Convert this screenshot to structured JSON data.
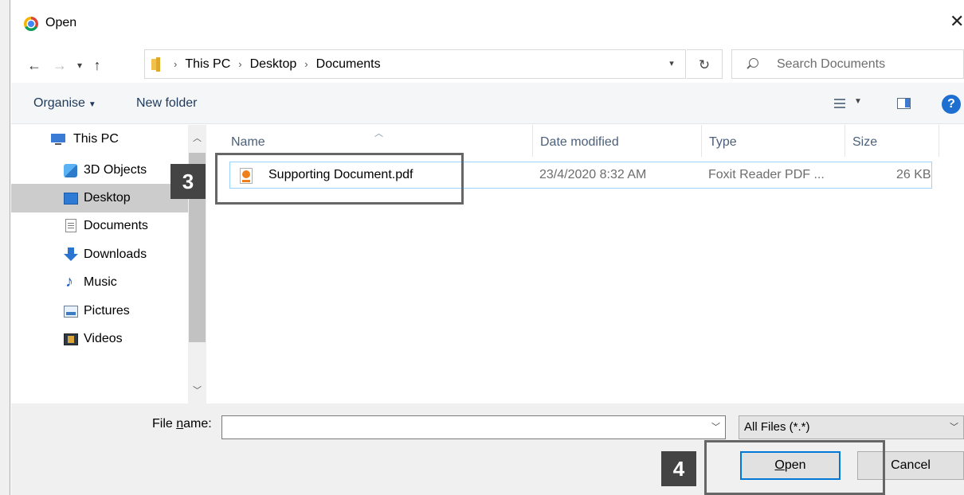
{
  "window": {
    "title": "Open"
  },
  "nav": {
    "breadcrumbs": [
      "This PC",
      "Desktop",
      "Documents"
    ],
    "search_placeholder": "Search Documents"
  },
  "toolbar": {
    "organise_label": "Organise",
    "new_folder_label": "New folder",
    "help_label": "?"
  },
  "sidebar": {
    "items": [
      {
        "label": "This PC",
        "icon": "computer-icon"
      },
      {
        "label": "3D Objects",
        "icon": "3d-objects-icon"
      },
      {
        "label": "Desktop",
        "icon": "desktop-icon",
        "selected": true
      },
      {
        "label": "Documents",
        "icon": "documents-icon"
      },
      {
        "label": "Downloads",
        "icon": "downloads-icon"
      },
      {
        "label": "Music",
        "icon": "music-icon"
      },
      {
        "label": "Pictures",
        "icon": "pictures-icon"
      },
      {
        "label": "Videos",
        "icon": "videos-icon"
      }
    ]
  },
  "filelist": {
    "columns": [
      "Name",
      "Date modified",
      "Type",
      "Size"
    ],
    "rows": [
      {
        "name": "Supporting Document.pdf",
        "date": "23/4/2020 8:32 AM",
        "type": "Foxit Reader PDF ...",
        "size": "26 KB"
      }
    ]
  },
  "footer": {
    "filename_label_prefix": "File ",
    "filename_label_mnemonic": "n",
    "filename_label_suffix": "ame:",
    "filename_value": "",
    "filter_value": "All Files (*.*)",
    "open_mnemonic": "O",
    "open_rest": "pen",
    "cancel_label": "Cancel"
  },
  "annotations": {
    "step3": "3",
    "step4": "4"
  },
  "colors": {
    "selected_row_border": "#99d1ff",
    "primary_button_border": "#0078d7",
    "callout": "#444444"
  }
}
